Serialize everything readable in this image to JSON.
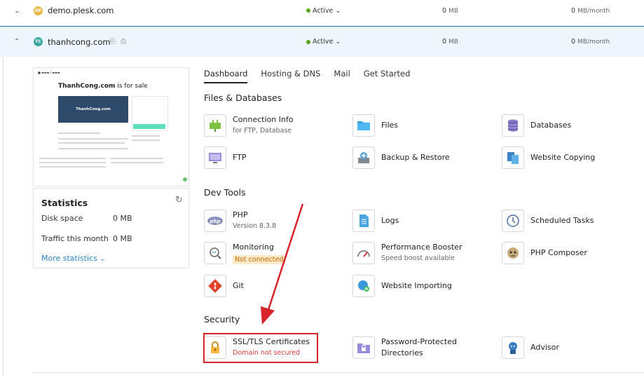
{
  "domains": [
    {
      "name": "demo.plesk.com",
      "avatar_color": "#e8b84a",
      "avatar_text": "DP",
      "status": "Active",
      "disk": "0",
      "disk_unit": "MB",
      "traffic": "0",
      "traffic_unit": "MB/month",
      "expanded": false
    },
    {
      "name": "thanhcong.com",
      "avatar_color": "#3aa7a0",
      "avatar_text": "TC",
      "status": "Active",
      "disk": "0",
      "disk_unit": "MB",
      "traffic": "0",
      "traffic_unit": "MB/month",
      "expanded": true
    }
  ],
  "preview": {
    "title_bold": "ThanhCong.com",
    "title_rest": " is for sale",
    "banner": "ThanhCong.com"
  },
  "statistics": {
    "title": "Statistics",
    "disk_label": "Disk space",
    "disk_value": "0 MB",
    "traffic_label": "Traffic this month",
    "traffic_value": "0 MB",
    "more": "More statistics"
  },
  "tabs": [
    "Dashboard",
    "Hosting & DNS",
    "Mail",
    "Get Started"
  ],
  "sections": {
    "files": "Files & Databases",
    "dev": "Dev Tools",
    "security": "Security"
  },
  "tools": {
    "connection_info": {
      "name": "Connection Info",
      "sub": "for FTP, Database"
    },
    "files": {
      "name": "Files"
    },
    "databases": {
      "name": "Databases"
    },
    "ftp": {
      "name": "FTP"
    },
    "backup": {
      "name": "Backup & Restore"
    },
    "website_copying": {
      "name": "Website Copying"
    },
    "php": {
      "name": "PHP",
      "sub": "Version 8.3.8"
    },
    "logs": {
      "name": "Logs"
    },
    "scheduled_tasks": {
      "name": "Scheduled Tasks"
    },
    "monitoring": {
      "name": "Monitoring",
      "sub": "Not connected"
    },
    "performance": {
      "name": "Performance Booster",
      "sub": "Speed boost available"
    },
    "composer": {
      "name": "PHP Composer"
    },
    "git": {
      "name": "Git"
    },
    "website_importing": {
      "name": "Website Importing"
    },
    "ssl": {
      "name": "SSL/TLS Certificates",
      "sub": "Domain not secured"
    },
    "password_dirs": {
      "name": "Password-Protected Directories"
    },
    "advisor": {
      "name": "Advisor"
    }
  },
  "colors": {
    "accent": "#2a82c3",
    "highlight": "#d9232a",
    "active": "#58a61c"
  }
}
